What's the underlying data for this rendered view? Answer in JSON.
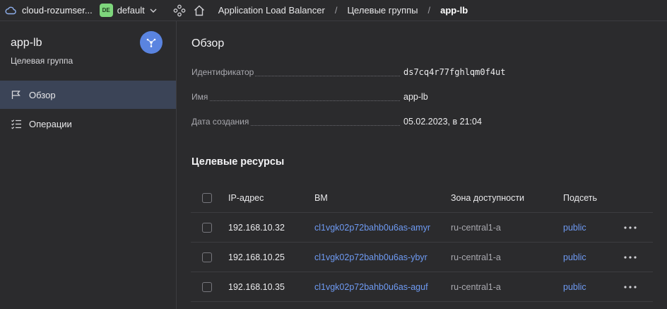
{
  "topbar": {
    "cloud_name": "cloud-rozumser...",
    "folder_badge": "DE",
    "folder_name": "default",
    "breadcrumbs": [
      "Application Load Balancer",
      "Целевые группы",
      "app-lb"
    ],
    "separator": "/"
  },
  "sidebar": {
    "title": "app-lb",
    "subtitle": "Целевая группа",
    "items": [
      {
        "label": "Обзор",
        "icon": "flag-icon",
        "active": true
      },
      {
        "label": "Операции",
        "icon": "checklist-icon",
        "active": false
      }
    ]
  },
  "overview": {
    "heading": "Обзор",
    "props": [
      {
        "label": "Идентификатор",
        "value": "ds7cq4r77fghlqm0f4ut"
      },
      {
        "label": "Имя",
        "value": "app-lb"
      },
      {
        "label": "Дата создания",
        "value": "05.02.2023, в 21:04"
      }
    ]
  },
  "resources": {
    "heading": "Целевые ресурсы",
    "columns": [
      "IP-адрес",
      "ВМ",
      "Зона доступности",
      "Подсеть"
    ],
    "rows": [
      {
        "ip": "192.168.10.32",
        "vm": "cl1vgk02p72bahb0u6as-amyr",
        "zone": "ru-central1-a",
        "subnet": "public"
      },
      {
        "ip": "192.168.10.25",
        "vm": "cl1vgk02p72bahb0u6as-ybyr",
        "zone": "ru-central1-a",
        "subnet": "public"
      },
      {
        "ip": "192.168.10.35",
        "vm": "cl1vgk02p72bahb0u6as-aguf",
        "zone": "ru-central1-a",
        "subnet": "public"
      }
    ]
  },
  "colors": {
    "background": "#2b2b2d",
    "active_nav": "#3b4457",
    "link": "#6e9af2",
    "avatar": "#5a84e0",
    "folder_badge": "#7ed67c"
  }
}
